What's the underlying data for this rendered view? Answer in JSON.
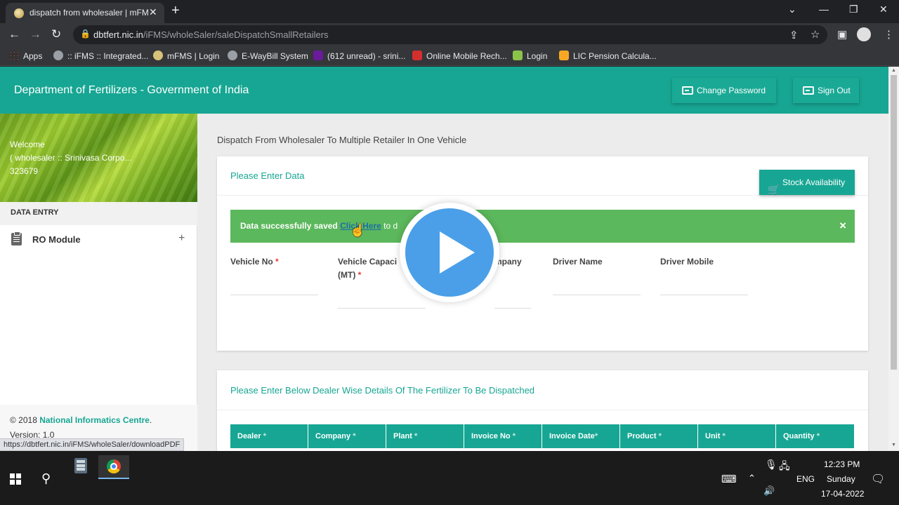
{
  "browser": {
    "tab_title": "dispatch from wholesaler | mFMS",
    "tab_close": "✕",
    "new_tab": "+",
    "url_host": "dbtfert.nic.in",
    "url_path": "/iFMS/wholeSaler/saleDispatchSmallRetailers",
    "bookmarks": [
      {
        "label": "Apps",
        "color": "#e8eaed"
      },
      {
        "label": ":: iFMS :: Integrated...",
        "color": "#9aa0a6"
      },
      {
        "label": "mFMS | Login",
        "color": "#d7c27a"
      },
      {
        "label": "E-WayBill System",
        "color": "#9aa0a6"
      },
      {
        "label": "(612 unread) - srini...",
        "color": "#6a1b9a"
      },
      {
        "label": "Online Mobile Rech...",
        "color": "#d32f2f"
      },
      {
        "label": "Login",
        "color": "#8bc34a"
      },
      {
        "label": "LIC Pension Calcula...",
        "color": "#f9a825"
      }
    ],
    "status_url": "https://dbtfert.nic.in/iFMS/wholeSaler/downloadPDF"
  },
  "header": {
    "title": "Department of Fertilizers - Government of India",
    "change_password": "Change Password",
    "sign_out": "Sign Out"
  },
  "sidebar": {
    "welcome": "Welcome",
    "user_line": "( wholesaler :: Srinivasa Corpo...",
    "user_id": "323679",
    "section": "DATA ENTRY",
    "module": "RO Module",
    "module_expand": "+",
    "copyright_prefix": "© 2018",
    "copyright_org": "National Informatics Centre",
    "copyright_suffix": ".",
    "version": "Version: 1.0"
  },
  "main": {
    "heading": "Dispatch From Wholesaler To Multiple Retailer In One Vehicle",
    "card1_title": "Please Enter Data",
    "stock_button": "Stock Availability",
    "alert_text": "Data successfully saved",
    "alert_link": "Click Here",
    "alert_rest": "to d",
    "alert_close": "×",
    "fields": [
      {
        "label": "Vehicle No",
        "required": true
      },
      {
        "label": "Vehicle Capaci",
        "label2": "(MT)",
        "required": true
      },
      {
        "label": "mpany",
        "required": false
      },
      {
        "label": "Driver Name",
        "required": false
      },
      {
        "label": "Driver Mobile",
        "required": false
      }
    ],
    "card2_title": "Please Enter Below Dealer Wise Details Of The Fertilizer To Be Dispatched",
    "table_columns": [
      "Dealer",
      "Company",
      "Plant",
      "Invoice No",
      "Invoice Date",
      "Product",
      "Unit",
      "Quantity"
    ]
  },
  "taskbar": {
    "language": "ENG",
    "time": "12:23 PM",
    "day": "Sunday",
    "date": "17-04-2022"
  },
  "colors": {
    "brand_teal": "#17a693",
    "success_green": "#5cb85c",
    "play_blue": "#4a9fe8"
  }
}
